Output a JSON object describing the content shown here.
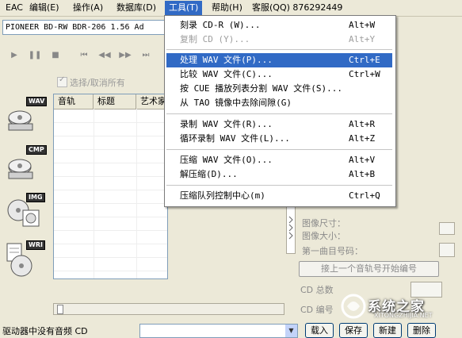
{
  "menubar": {
    "items": [
      {
        "label": "EAC"
      },
      {
        "label": "编辑(E)"
      },
      {
        "label": "操作(A)"
      },
      {
        "label": "数据库(D)"
      },
      {
        "label": "工具(T)"
      },
      {
        "label": "帮助(H)"
      }
    ],
    "qq": "客服(QQ) 876292449",
    "active_color": "#316ac5"
  },
  "drive": {
    "value": "PIONEER BD-RW   BDR-206 1.56   Ad"
  },
  "transport": {
    "buttons": [
      {
        "icon": "play-icon",
        "glyph": "▶"
      },
      {
        "icon": "pause-icon",
        "glyph": "❚❚"
      },
      {
        "icon": "stop-icon",
        "glyph": "■"
      },
      {
        "icon": "prev-track-icon",
        "glyph": "⏮"
      },
      {
        "icon": "rewind-icon",
        "glyph": "◀◀"
      },
      {
        "icon": "fast-forward-icon",
        "glyph": "▶▶"
      },
      {
        "icon": "next-track-icon",
        "glyph": "⏭"
      }
    ]
  },
  "select_all": {
    "label": "选择/取消所有"
  },
  "side_icons": [
    {
      "icon": "wav-icon",
      "tag": "WAV"
    },
    {
      "icon": "cmp-icon",
      "tag": "CMP"
    },
    {
      "icon": "img-icon",
      "tag": "IMG"
    },
    {
      "icon": "wri-icon",
      "tag": "WRI"
    }
  ],
  "track_table": {
    "columns": [
      "音轨",
      "标题",
      "艺术家"
    ]
  },
  "right_panel": {
    "image_size_label": "图像尺寸：",
    "image_size2_label": "图像大小：",
    "first_track_label": "第一曲目号码：",
    "prev_track_button": "接上一个音轨号开始编号",
    "cd_total_label": "CD 总数",
    "cd_number_label": "CD 编号"
  },
  "statusbar": {
    "text": "驱动器中没有音频 CD",
    "buttons": [
      "载入",
      "保存",
      "新建",
      "删除"
    ]
  },
  "dropdown": {
    "items": [
      {
        "label": "刻录 CD-R (W)...",
        "shortcut": "Alt+W",
        "disabled": false,
        "highlight": false
      },
      {
        "label": "复制 CD (Y)...",
        "shortcut": "Alt+Y",
        "disabled": true,
        "highlight": false
      },
      {
        "label": "处理 WAV 文件(P)...",
        "shortcut": "Ctrl+E",
        "disabled": false,
        "highlight": true
      },
      {
        "label": "比较 WAV 文件(C)...",
        "shortcut": "Ctrl+W",
        "disabled": false,
        "highlight": false
      },
      {
        "label": "按 CUE 播放列表分割 WAV 文件(S)...",
        "shortcut": "",
        "disabled": false,
        "highlight": false
      },
      {
        "label": "从 TAO 镜像中去除间隙(G)",
        "shortcut": "",
        "disabled": false,
        "highlight": false
      },
      {
        "label": "录制 WAV 文件(R)...",
        "shortcut": "Alt+R",
        "disabled": false,
        "highlight": false
      },
      {
        "label": "循环录制 WAV 文件(L)...",
        "shortcut": "Alt+Z",
        "disabled": false,
        "highlight": false
      },
      {
        "label": "压缩 WAV 文件(O)...",
        "shortcut": "Alt+V",
        "disabled": false,
        "highlight": false
      },
      {
        "label": "解压缩(D)...",
        "shortcut": "Alt+B",
        "disabled": false,
        "highlight": false
      },
      {
        "label": "压缩队列控制中心(m)",
        "shortcut": "Ctrl+Q",
        "disabled": false,
        "highlight": false
      }
    ]
  },
  "watermark": {
    "text": "系统之家",
    "url": "XITONGZHIJIA.NET"
  }
}
